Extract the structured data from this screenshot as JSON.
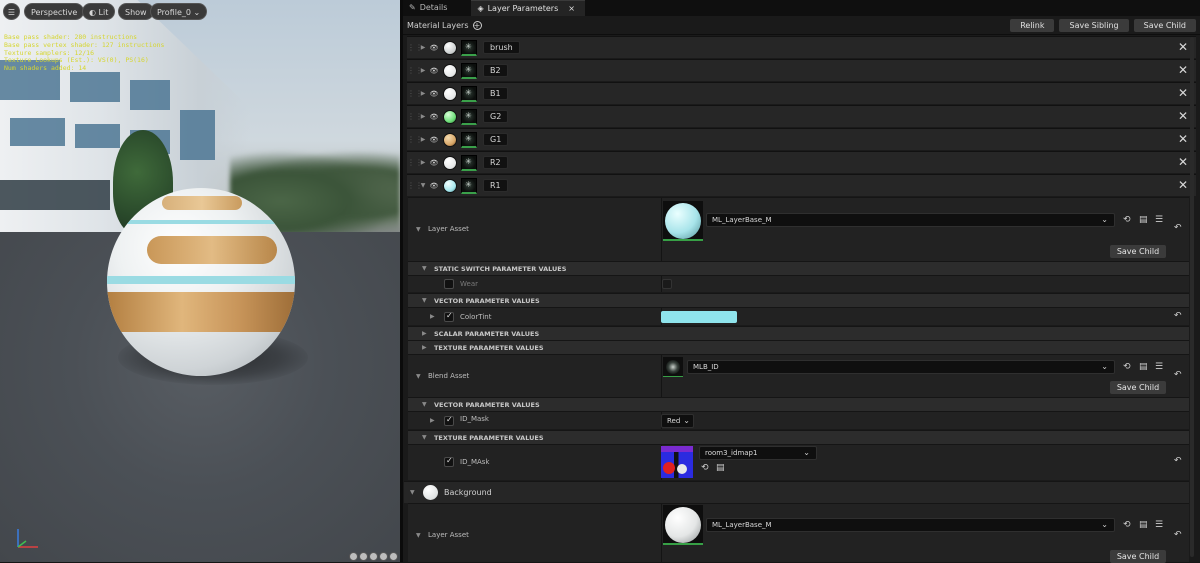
{
  "viewport": {
    "buttons": [
      "Perspective",
      "Lit",
      "Show",
      "Profile_0"
    ],
    "hud_lines": [
      "Base pass shader: 280 instructions",
      "Base pass vertex shader: 127 instructions",
      "Texture samplers: 12/16",
      "Texture Lookups (Est.): VS(0), PS(16)",
      "Num shaders added: 14"
    ]
  },
  "tabs": [
    {
      "label": "Details"
    },
    {
      "label": "Layer Parameters",
      "close": "×"
    }
  ],
  "toolbar": {
    "title": "Material Layers",
    "add": "+",
    "buttons": [
      "Relink",
      "Save Sibling",
      "Save Child"
    ]
  },
  "layers": [
    {
      "name": "brush",
      "ball_color": "#e8ecec",
      "close": "✕"
    },
    {
      "name": "B2",
      "ball_color": "#f0f2f2",
      "close": "✕"
    },
    {
      "name": "B1",
      "ball_color": "#f0f2f2",
      "close": "✕"
    },
    {
      "name": "G2",
      "ball_color": "#6fdf7a",
      "close": "✕"
    },
    {
      "name": "G1",
      "ball_color": "#d9a86a",
      "close": "✕"
    },
    {
      "name": "R2",
      "ball_color": "#f0f2f2",
      "close": "✕"
    },
    {
      "name": "R1",
      "ball_color": "#a8e8ee",
      "close": "✕"
    }
  ],
  "r1_params": {
    "layer_asset_label": "Layer Asset",
    "layer_asset_value": "ML_LayerBase_M",
    "save_child": "Save Child",
    "static_switch_title": "STATIC SWITCH PARAMETER VALUES",
    "wear_label": "Wear",
    "vector_title": "VECTOR PARAMETER VALUES",
    "color_tint_label": "ColorTint",
    "color_tint_value": "#8fe4ec",
    "scalar_title": "SCALAR PARAMETER VALUES",
    "texture_title": "TEXTURE PARAMETER VALUES",
    "blend_asset_label": "Blend Asset",
    "blend_asset_value": "MLB_ID",
    "save_child_2": "Save Child",
    "vector_title_2": "VECTOR PARAMETER VALUES",
    "id_mask_label": "ID_Mask",
    "id_mask_value": "Red",
    "texture_title_2": "TEXTURE PARAMETER VALUES",
    "id_mask_tex_label": "ID_MAsk",
    "id_mask_tex_value": "room3_idmap1"
  },
  "background": {
    "label": "Background",
    "layer_asset_label": "Layer Asset",
    "layer_asset_value": "ML_LayerBase_M",
    "save_child": "Save Child"
  }
}
